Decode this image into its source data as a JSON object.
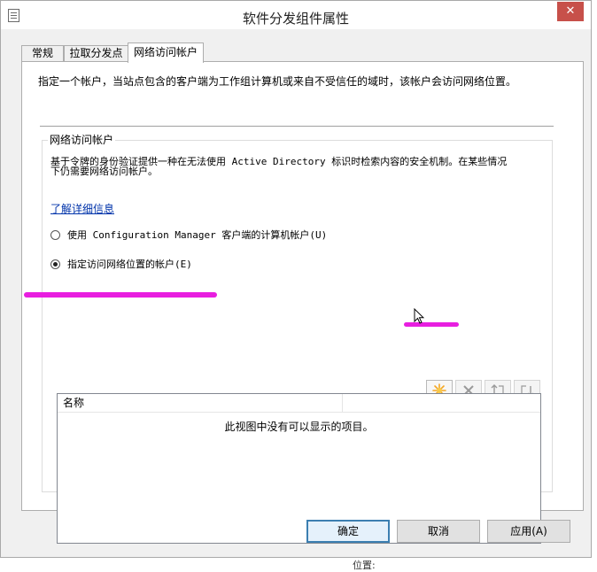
{
  "window": {
    "title": "软件分发组件属性",
    "close_label": "✕"
  },
  "tabs": [
    {
      "label": "常规"
    },
    {
      "label": "拉取分发点"
    },
    {
      "label": "网络访问帐户",
      "active": true
    }
  ],
  "description": "指定一个帐户，当站点包含的客户端为工作组计算机或来自不受信任的域时，该帐户会访问网络位置。",
  "group": {
    "title": "网络访问帐户",
    "body_line1": "基于令牌的身份验证提供一种在无法使用 Active Directory 标识时检索内容的安全机制。在某些情况",
    "body_line2": "下仍需要网络访问帐户。",
    "link": "了解详细信息",
    "radio_computer_account": "使用 Configuration Manager 客户端的计算机帐户(U)",
    "radio_specify_account": "指定访问网络位置的帐户(E)",
    "selected_option": "specify"
  },
  "toolbar": {
    "new_icon": "starburst-new-icon",
    "delete_icon": "delete-x-icon",
    "move_up_icon": "move-up-icon",
    "move_down_icon": "move-down-icon"
  },
  "list": {
    "column_name": "名称",
    "empty_text": "此视图中没有可以显示的项目。"
  },
  "buttons": {
    "ok": "确定",
    "cancel": "取消",
    "apply": "应用(A)"
  },
  "underlying_text": "位置:",
  "colors": {
    "annotation": "#e81ee0",
    "link": "#0033aa",
    "default_button_border": "#3c7fb1",
    "new_icon": "#f5a623"
  }
}
